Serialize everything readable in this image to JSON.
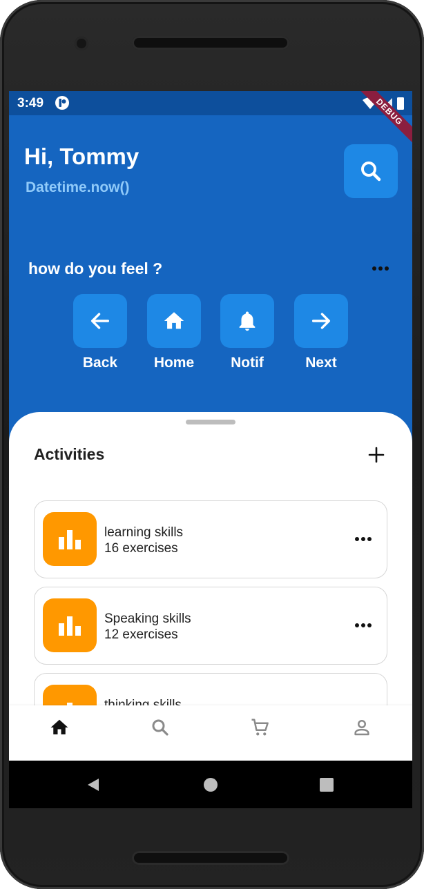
{
  "status_bar": {
    "time": "3:49",
    "debug_label": "DEBUG"
  },
  "header": {
    "greeting": "Hi, Tommy",
    "subtitle": "Datetime.now()"
  },
  "feel": {
    "title": "how do you feel ?"
  },
  "quick_actions": [
    {
      "label": "Back",
      "icon": "arrow-left-icon"
    },
    {
      "label": "Home",
      "icon": "home-icon"
    },
    {
      "label": "Notif",
      "icon": "bell-icon"
    },
    {
      "label": "Next",
      "icon": "arrow-right-icon"
    }
  ],
  "activities": {
    "title": "Activities",
    "items": [
      {
        "name": "learning skills",
        "count": "16 exercises"
      },
      {
        "name": "Speaking skills",
        "count": "12 exercises"
      },
      {
        "name": "thinking skills",
        "count": ""
      }
    ]
  },
  "bottom_nav": {
    "items": [
      "home-icon",
      "search-icon",
      "cart-icon",
      "person-icon"
    ],
    "active": "home-icon"
  },
  "colors": {
    "primary": "#1565c0",
    "button": "#1e88e5",
    "accent": "#ff9800",
    "subtitle": "#90caf9"
  }
}
